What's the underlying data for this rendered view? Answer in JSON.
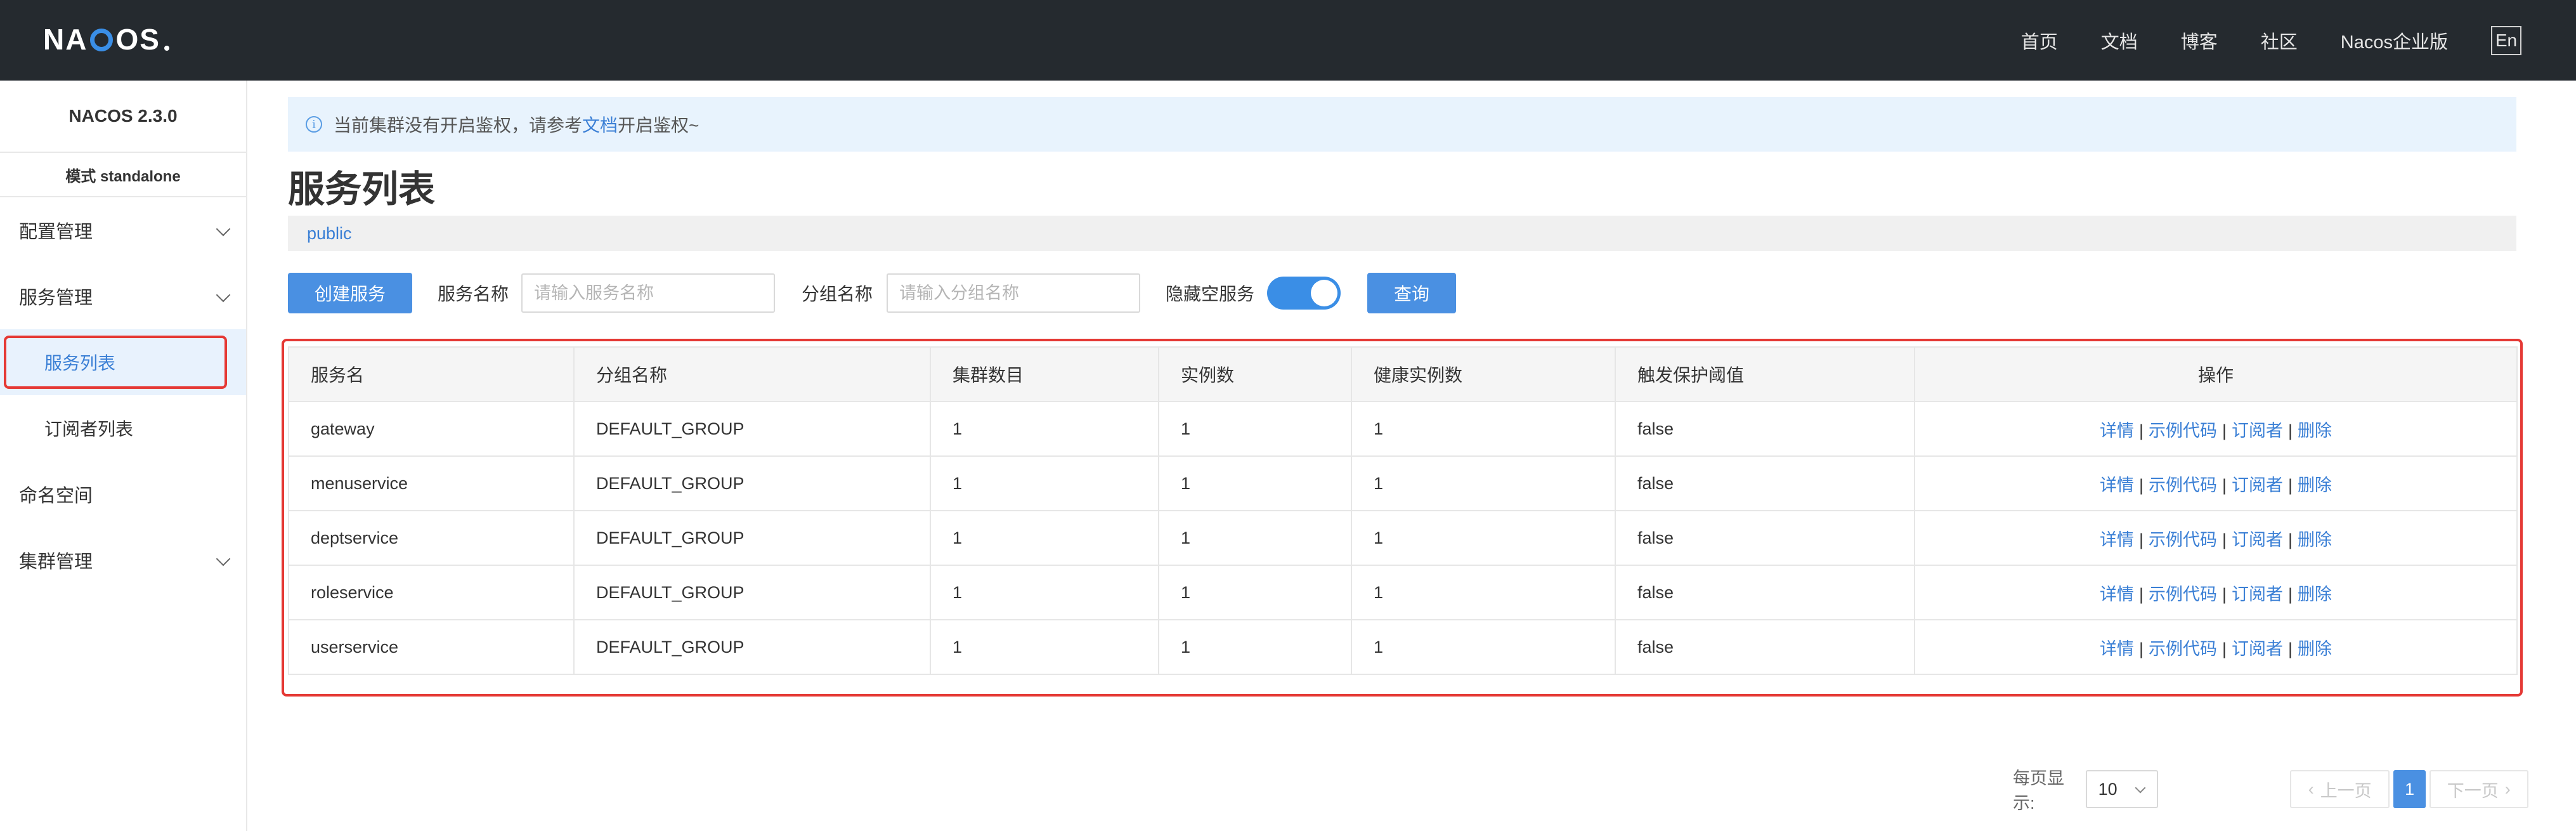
{
  "header": {
    "logo": {
      "part1": "NA",
      "part2": "OS"
    },
    "nav": [
      "首页",
      "文档",
      "博客",
      "社区",
      "Nacos企业版"
    ],
    "lang_button": "En",
    "colors": {
      "background": "#252a2f",
      "accent": "#3a8ee6"
    }
  },
  "sidebar": {
    "version": "NACOS 2.3.0",
    "mode": "模式 standalone",
    "menu": [
      {
        "label": "配置管理",
        "expandable": true
      },
      {
        "label": "服务管理",
        "expandable": true,
        "children": [
          {
            "label": "服务列表",
            "active": true
          },
          {
            "label": "订阅者列表",
            "active": false
          }
        ]
      },
      {
        "label": "命名空间",
        "expandable": false
      },
      {
        "label": "集群管理",
        "expandable": true
      }
    ]
  },
  "notice": {
    "icon": "info-icon",
    "text_before": "当前集群没有开启鉴权，请参考",
    "link_text": "文档",
    "text_after": "开启鉴权~"
  },
  "page_title": "服务列表",
  "namespace": "public",
  "filters": {
    "create_button": "创建服务",
    "service_name_label": "服务名称",
    "service_name_placeholder": "请输入服务名称",
    "service_name_value": "",
    "group_name_label": "分组名称",
    "group_name_placeholder": "请输入分组名称",
    "group_name_value": "",
    "hide_empty_label": "隐藏空服务",
    "hide_empty_enabled": true,
    "query_button": "查询"
  },
  "table": {
    "columns": [
      "服务名",
      "分组名称",
      "集群数目",
      "实例数",
      "健康实例数",
      "触发保护阈值",
      "操作"
    ],
    "operations": [
      "详情",
      "示例代码",
      "订阅者",
      "删除"
    ],
    "rows": [
      {
        "name": "gateway",
        "group": "DEFAULT_GROUP",
        "clusters": "1",
        "instances": "1",
        "healthy": "1",
        "protect": "false"
      },
      {
        "name": "menuservice",
        "group": "DEFAULT_GROUP",
        "clusters": "1",
        "instances": "1",
        "healthy": "1",
        "protect": "false"
      },
      {
        "name": "deptservice",
        "group": "DEFAULT_GROUP",
        "clusters": "1",
        "instances": "1",
        "healthy": "1",
        "protect": "false"
      },
      {
        "name": "roleservice",
        "group": "DEFAULT_GROUP",
        "clusters": "1",
        "instances": "1",
        "healthy": "1",
        "protect": "false"
      },
      {
        "name": "userservice",
        "group": "DEFAULT_GROUP",
        "clusters": "1",
        "instances": "1",
        "healthy": "1",
        "protect": "false"
      }
    ]
  },
  "pagination": {
    "page_size_label": "每页显示:",
    "page_size": "10",
    "prev_label": "上一页",
    "current_page": "1",
    "next_label": "下一页"
  }
}
